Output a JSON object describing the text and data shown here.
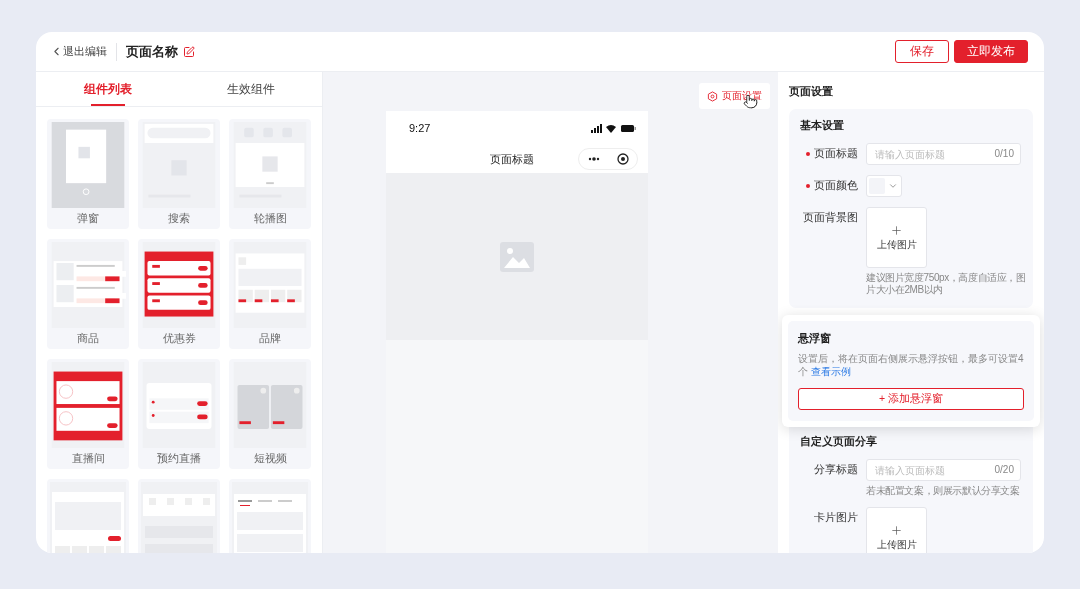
{
  "header": {
    "back": "退出编辑",
    "title": "页面名称",
    "buttons": [
      {
        "label": "保存",
        "kind": "outline"
      },
      {
        "label": "立即发布",
        "kind": "primary"
      }
    ]
  },
  "left_panel": {
    "tabs": [
      {
        "label": "组件列表",
        "selected": true
      },
      {
        "label": "生效组件",
        "selected": false
      }
    ],
    "components": [
      {
        "label": "弹窗",
        "kind": "popup"
      },
      {
        "label": "搜索",
        "kind": "search"
      },
      {
        "label": "轮播图",
        "kind": "carousel"
      },
      {
        "label": "商品",
        "kind": "product"
      },
      {
        "label": "优惠券",
        "kind": "coupon"
      },
      {
        "label": "品牌",
        "kind": "brand"
      },
      {
        "label": "直播间",
        "kind": "live"
      },
      {
        "label": "预约直播",
        "kind": "reservation"
      },
      {
        "label": "短视频",
        "kind": "video"
      },
      {
        "kind": "feature"
      },
      {
        "kind": "shortcuts"
      },
      {
        "kind": "tabs"
      }
    ]
  },
  "canvas": {
    "settings_button": "页面设置",
    "phone": {
      "time": "9:27",
      "title": "页面标题"
    }
  },
  "settings": {
    "title": "页面设置",
    "basic": {
      "heading": "基本设置",
      "fields": [
        {
          "kind": "text",
          "label": "页面标题",
          "required": true,
          "placeholder": "请输入页面标题",
          "counter": "0/10"
        },
        {
          "kind": "color",
          "label": "页面颜色",
          "required": true
        },
        {
          "kind": "upload",
          "label": "页面背景图",
          "required": false,
          "upload_label": "上传图片",
          "hint": "建议图片宽度750px，高度自适应，图片大小在2MB以内"
        }
      ]
    },
    "floating": {
      "heading": "悬浮窗",
      "description": "设置后，将在页面右侧展示悬浮按钮，最多可设置4个",
      "link": "查看示例",
      "button": "+ 添加悬浮窗"
    },
    "share": {
      "heading": "自定义页面分享",
      "fields": [
        {
          "kind": "text",
          "label": "分享标题",
          "required": false,
          "placeholder": "请输入页面标题",
          "counter": "0/20",
          "hint": "若未配置文案，则展示默认分享文案"
        },
        {
          "kind": "upload",
          "label": "卡片图片",
          "required": false,
          "upload_label": "上传图片"
        }
      ]
    }
  }
}
